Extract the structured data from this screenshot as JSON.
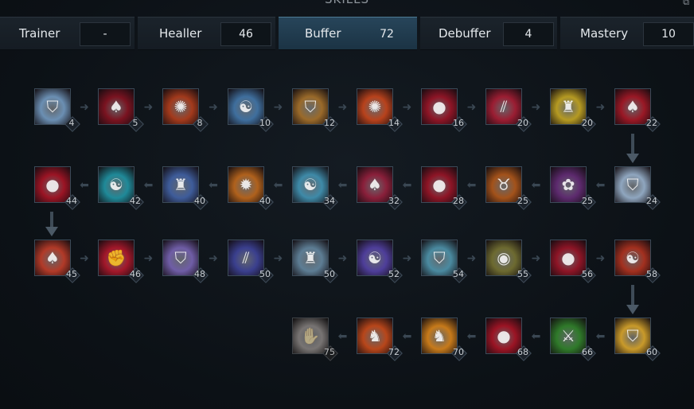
{
  "header": {
    "title": "SKILLS",
    "corner_icon": "menu-icon"
  },
  "tabs": [
    {
      "label": "Trainer",
      "value": "-"
    },
    {
      "label": "Healler",
      "value": "46"
    },
    {
      "label": "Buffer",
      "value": "72",
      "active": true
    },
    {
      "label": "Debuffer",
      "value": "4"
    },
    {
      "label": "Mastery",
      "value": "10"
    }
  ],
  "skills": [
    {
      "level": "4",
      "icon": "shield-icon",
      "color": "#6b8fb3"
    },
    {
      "level": "5",
      "icon": "blood-flame-icon",
      "color": "#7a1320"
    },
    {
      "level": "8",
      "icon": "fire-burst-icon",
      "color": "#a33a1c"
    },
    {
      "level": "10",
      "icon": "meditate-icon",
      "color": "#3f6f9e"
    },
    {
      "level": "12",
      "icon": "shield-icon",
      "color": "#9a6a2a"
    },
    {
      "level": "14",
      "icon": "fire-burst-icon",
      "color": "#b8421c"
    },
    {
      "level": "16",
      "icon": "blood-drop-icon",
      "color": "#8e1526"
    },
    {
      "level": "20",
      "icon": "claw-icon",
      "color": "#9b1d32"
    },
    {
      "level": "20",
      "icon": "armor-icon",
      "color": "#b59a22"
    },
    {
      "level": "22",
      "icon": "blood-flame-icon",
      "color": "#9a1825"
    },
    {
      "level": "24",
      "icon": "shield-icon",
      "color": "#8fa6bf"
    },
    {
      "level": "25",
      "icon": "spiral-icon",
      "color": "#5d2a6e"
    },
    {
      "level": "25",
      "icon": "bull-icon",
      "color": "#a3521a"
    },
    {
      "level": "28",
      "icon": "blood-drop-icon",
      "color": "#8e1526"
    },
    {
      "level": "32",
      "icon": "blood-flame-icon",
      "color": "#8a1f3a"
    },
    {
      "level": "34",
      "icon": "meditate-icon",
      "color": "#3e8aa8"
    },
    {
      "level": "40",
      "icon": "fire-pillar-icon",
      "color": "#b0611c"
    },
    {
      "level": "40",
      "icon": "armor-icon",
      "color": "#3e5c9a"
    },
    {
      "level": "42",
      "icon": "meditate-icon",
      "color": "#1f8a99"
    },
    {
      "level": "44",
      "icon": "blood-drop-icon",
      "color": "#9b1424"
    },
    {
      "level": "45",
      "icon": "blood-flame-icon",
      "color": "#b23a28"
    },
    {
      "level": "46",
      "icon": "fist-icon",
      "color": "#a3182a"
    },
    {
      "level": "48",
      "icon": "shield-icon",
      "color": "#6f5da6"
    },
    {
      "level": "50",
      "icon": "claw-icon",
      "color": "#3a3f8e"
    },
    {
      "level": "50",
      "icon": "armor-icon",
      "color": "#5d7d94"
    },
    {
      "level": "52",
      "icon": "meditate-icon",
      "color": "#4e3e9a"
    },
    {
      "level": "54",
      "icon": "shield-icon",
      "color": "#4a8aa0"
    },
    {
      "level": "55",
      "icon": "orb-icon",
      "color": "#6d6a30"
    },
    {
      "level": "56",
      "icon": "blood-drop-icon",
      "color": "#8e1526"
    },
    {
      "level": "58",
      "icon": "meditate-icon",
      "color": "#a3301f"
    },
    {
      "level": "60",
      "icon": "shield-icon",
      "color": "#c99a2a"
    },
    {
      "level": "66",
      "icon": "slash-icon",
      "color": "#2f7a2a"
    },
    {
      "level": "68",
      "icon": "blood-drop-icon",
      "color": "#9b1424"
    },
    {
      "level": "70",
      "icon": "warrior-icon",
      "color": "#c77a1a"
    },
    {
      "level": "72",
      "icon": "warrior-icon",
      "color": "#b8461a"
    },
    {
      "level": "75",
      "icon": "hand-icon",
      "color": "#8d7f7a",
      "locked": true
    }
  ]
}
